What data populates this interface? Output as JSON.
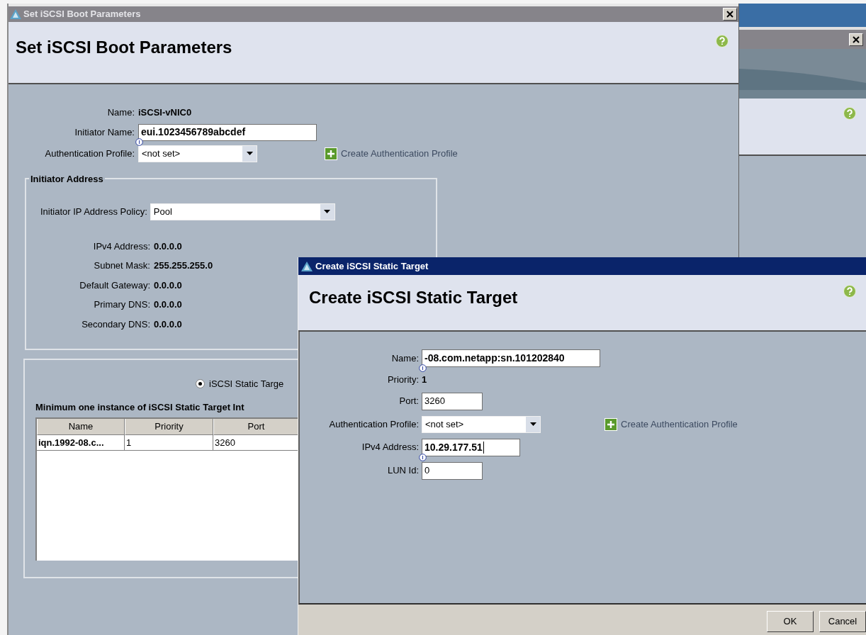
{
  "main_window": {
    "title": "Set iSCSI Boot Parameters",
    "heading": "Set iSCSI Boot Parameters",
    "name": {
      "label": "Name:",
      "value": "iSCSI-vNIC0"
    },
    "initiator_name": {
      "label": "Initiator Name:",
      "value": "eui.1023456789abcdef"
    },
    "auth_profile": {
      "label": "Authentication Profile:",
      "value": "<not set>"
    },
    "create_auth_link": "Create Authentication Profile",
    "initiator_address": {
      "legend": "Initiator Address",
      "policy": {
        "label": "Initiator IP Address Policy:",
        "value": "Pool"
      },
      "info": [
        {
          "label": "IPv4 Address:",
          "value": "0.0.0.0"
        },
        {
          "label": "Subnet Mask:",
          "value": "255.255.255.0"
        },
        {
          "label": "Default Gateway:",
          "value": "0.0.0.0"
        },
        {
          "label": "Primary DNS:",
          "value": "0.0.0.0"
        },
        {
          "label": "Secondary DNS:",
          "value": "0.0.0.0"
        }
      ]
    },
    "targets": {
      "options": [
        {
          "label": "iSCSI Static Targe",
          "selected": true
        }
      ],
      "note": "Minimum one instance of iSCSI Static Target Int",
      "columns": [
        "Name",
        "Priority",
        "Port"
      ],
      "rows": [
        [
          "iqn.1992-08.c...",
          "1",
          "3260"
        ]
      ]
    }
  },
  "dialog": {
    "title": "Create iSCSI Static Target",
    "heading": "Create iSCSI Static Target",
    "fields": [
      {
        "kind": "input",
        "label": "Name:",
        "value": "-08.com.netapp:sn.101202840",
        "strong": true,
        "focused": false
      },
      {
        "kind": "static",
        "label": "Priority:",
        "value": "1"
      },
      {
        "kind": "input",
        "label": "Port:",
        "value": "3260",
        "strong": false,
        "focused": false
      },
      {
        "kind": "select",
        "label": "Authentication Profile:",
        "value": "<not set>",
        "link": "Create Authentication Profile"
      },
      {
        "kind": "input",
        "label": "IPv4 Address:",
        "value": "10.29.177.51",
        "strong": true,
        "focused": true
      },
      {
        "kind": "input",
        "label": "LUN Id:",
        "value": "0",
        "strong": false,
        "focused": false
      }
    ],
    "buttons": [
      "OK",
      "Cancel"
    ]
  }
}
